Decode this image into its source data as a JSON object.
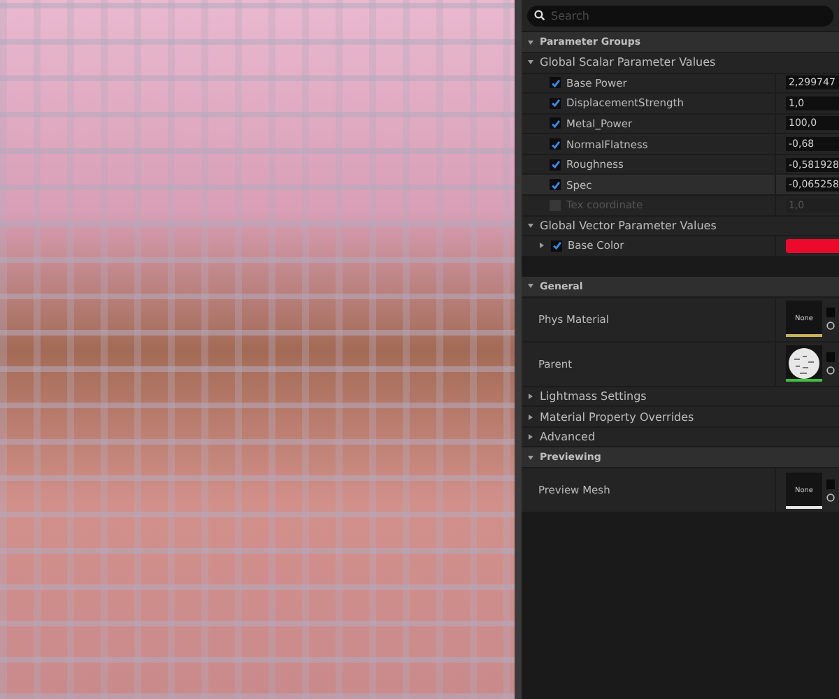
{
  "search": {
    "placeholder": "Search"
  },
  "categories": [
    {
      "title": "Parameter Groups",
      "expanded": true,
      "children": [
        {
          "kind": "group",
          "title": "Global Scalar Parameter Values",
          "expanded": true,
          "children": [
            {
              "kind": "scalar",
              "name": "Base Power",
              "value": "2,299747",
              "checked": true,
              "disabled": false,
              "selected": false
            },
            {
              "kind": "scalar",
              "name": "DisplacementStrength",
              "value": "1,0",
              "checked": true,
              "disabled": false,
              "selected": false
            },
            {
              "kind": "scalar",
              "name": "Metal_Power",
              "value": "100,0",
              "checked": true,
              "disabled": false,
              "selected": false
            },
            {
              "kind": "scalar",
              "name": "NormalFlatness",
              "value": "-0,68",
              "checked": true,
              "disabled": false,
              "selected": false
            },
            {
              "kind": "scalar",
              "name": "Roughness",
              "value": "-0,581928",
              "checked": true,
              "disabled": false,
              "selected": false
            },
            {
              "kind": "scalar",
              "name": "Spec",
              "value": "-0,065258",
              "checked": true,
              "disabled": false,
              "selected": true
            },
            {
              "kind": "scalar",
              "name": "Tex coordinate",
              "value": "1,0",
              "checked": false,
              "disabled": true,
              "selected": false
            }
          ]
        },
        {
          "kind": "group",
          "title": "Global Vector Parameter Values",
          "expanded": true,
          "children": [
            {
              "kind": "vector",
              "name": "Base Color",
              "checked": true,
              "expanded": false,
              "color": "#ec0a2c"
            }
          ]
        }
      ]
    },
    {
      "title": "General",
      "expanded": true,
      "children": [
        {
          "kind": "asset",
          "name": "Phys Material",
          "thumbnail": "None",
          "color": "#c9b45a"
        },
        {
          "kind": "asset",
          "name": "Parent",
          "color": "#3fbf3f"
        },
        {
          "kind": "group",
          "title": "Lightmass Settings",
          "expanded": false
        },
        {
          "kind": "group",
          "title": "Material Property Overrides",
          "expanded": false
        },
        {
          "kind": "group",
          "title": "Advanced",
          "expanded": false
        }
      ]
    },
    {
      "title": "Previewing",
      "expanded": true,
      "children": [
        {
          "kind": "asset",
          "name": "Preview Mesh",
          "thumbnail": "None",
          "color": "#e6e6e6"
        }
      ]
    }
  ]
}
